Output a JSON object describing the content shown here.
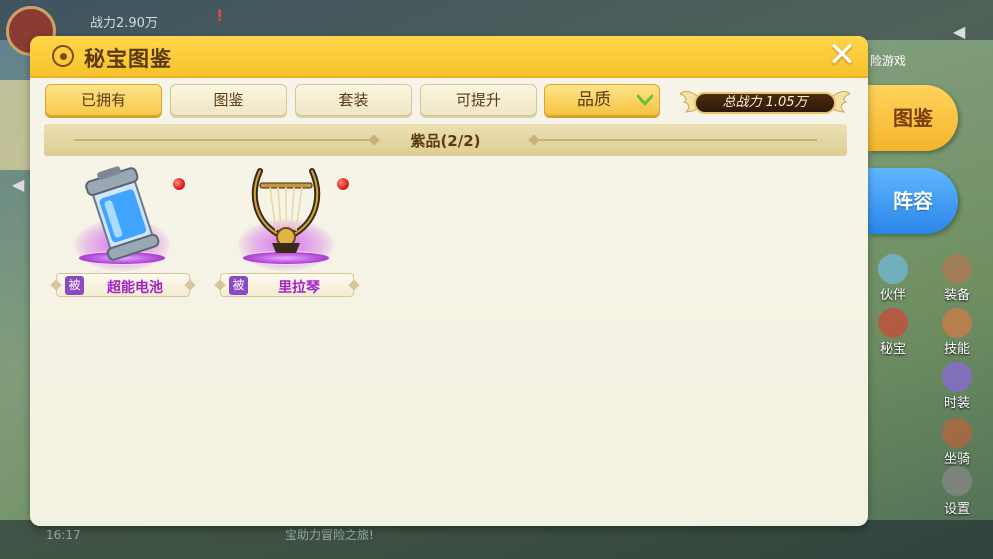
{
  "background": {
    "power_text": "战力2.90万",
    "exclaim": "!",
    "top_right_text": "险游戏",
    "time": "16:17",
    "bottom_msg": "宝助力冒险之旅!",
    "menu": [
      {
        "label": "伙伴",
        "icon": "partner-icon",
        "color": "#6fb9d8"
      },
      {
        "label": "装备",
        "icon": "equipment-icon",
        "color": "#b07a54"
      },
      {
        "label": "秘宝",
        "icon": "treasure-icon",
        "color": "#c94a3a"
      },
      {
        "label": "技能",
        "icon": "skill-icon",
        "color": "#d07a48"
      },
      {
        "label": "时装",
        "icon": "fashion-icon",
        "color": "#8a6ad8"
      },
      {
        "label": "坐骑",
        "icon": "mount-icon",
        "color": "#b7643e"
      },
      {
        "label": "设置",
        "icon": "settings-icon",
        "color": "#888888"
      }
    ]
  },
  "panel": {
    "title": "秘宝图鉴",
    "close": "✕",
    "tabs": [
      {
        "label": "已拥有",
        "active": true
      },
      {
        "label": "图鉴",
        "active": false
      },
      {
        "label": "套装",
        "active": false
      },
      {
        "label": "可提升",
        "active": false
      }
    ],
    "quality_filter": "品质",
    "total_power": "总战力 1.05万",
    "section_title": "紫品(2/2)",
    "items": [
      {
        "name": "超能电池",
        "tag": "被",
        "art": "battery-icon",
        "has_red_dot": true
      },
      {
        "name": "里拉琴",
        "tag": "被",
        "art": "lyre-icon",
        "has_red_dot": true
      }
    ]
  },
  "side_tabs": [
    {
      "label": "图鉴",
      "active": true
    },
    {
      "label": "阵容",
      "active": false
    }
  ],
  "colors": {
    "header": "#f7c22c",
    "rarity_purple": "#a322c9",
    "passive_tag": "#8b4ac2",
    "red_dot": "#e01e12"
  }
}
